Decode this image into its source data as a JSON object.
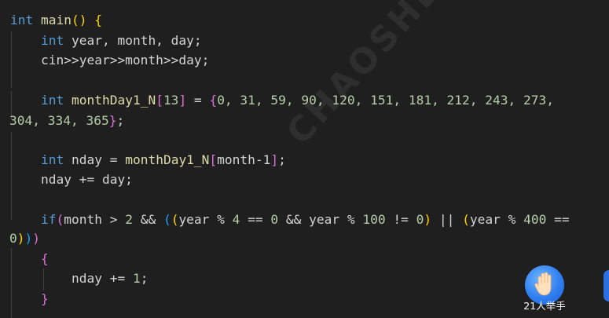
{
  "code": {
    "l1": {
      "kw": "int",
      "fn": "main",
      "paren": "()",
      "brace": "{"
    },
    "l2": {
      "kw": "int",
      "text": "year, month, day;"
    },
    "l3": {
      "text": "cin>>year>>month>>day;"
    },
    "l5": {
      "kw": "int",
      "name": "monthDay1_N",
      "bo": "[",
      "size": "13",
      "bc": "]",
      "eq": " = ",
      "ob": "{",
      "nums": "0, 31, 59, 90, 120, 151, 181, 212, 243, 273,"
    },
    "l6": {
      "nums": "304, 334, 365",
      "cb": "}",
      "semi": ";"
    },
    "l8": {
      "kw": "int",
      "lhs": "nday = ",
      "arr": "monthDay1_N",
      "bo": "[",
      "idx": "month-1",
      "bc": "]",
      "semi": ";"
    },
    "l9": {
      "text": "nday += day;"
    },
    "l11": {
      "kw": "if",
      "p1": "(",
      "c1": "month > ",
      "n2": "2",
      "and1": " && ",
      "p2": "(",
      "p3": "(",
      "c2": "year % ",
      "n4": "4",
      "eq1": " == ",
      "n0a": "0",
      "and2": " && ",
      "c3": "year % ",
      "n100": "100",
      "neq": " != ",
      "n0b": "0",
      "p3c": ")",
      "or": " || ",
      "p4": "(",
      "c4": "year % ",
      "n400": "400",
      "eq2": " =="
    },
    "l12": {
      "n0": "0",
      "p4c": ")",
      "p2c": ")",
      "p1c": ")"
    },
    "l13": {
      "brace": "{"
    },
    "l14": {
      "text": "nday += ",
      "num": "1",
      "semi": ";"
    },
    "l15": {
      "brace": "}"
    }
  },
  "watermark": "CHAOSHEN",
  "raise_hand": {
    "icon": "raised-hand-icon",
    "label": "21人举手"
  },
  "colors": {
    "background": "#1f1f1f",
    "keyword": "#569cd6",
    "function": "#dcdcaa",
    "number": "#b5cea8",
    "bracket_gold": "#ffd700",
    "bracket_purple": "#da70d6",
    "bracket_blue": "#179fff",
    "badge": "#2f7ff0"
  }
}
